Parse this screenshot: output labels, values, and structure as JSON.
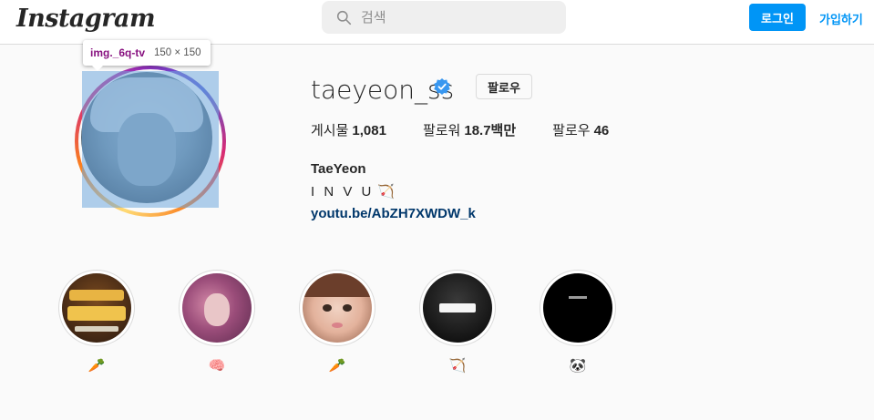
{
  "header": {
    "logo": "Instagram",
    "search_placeholder": "검색",
    "login_label": "로그인",
    "signup_label": "가입하기",
    "accent_color": "#0095f6"
  },
  "devtools_tooltip": {
    "selector": "img._6q-tv",
    "dimensions": "150 × 150"
  },
  "profile": {
    "username": "taeyeon_ss",
    "verified_icon": "verified-badge-icon",
    "follow_label": "팔로우",
    "stats": [
      {
        "label": "게시물",
        "value": "1,081"
      },
      {
        "label": "팔로워",
        "value": "18.7백만"
      },
      {
        "label": "팔로우",
        "value": "46"
      }
    ],
    "full_name": "TaeYeon",
    "bio_text": "I N V U",
    "bio_emoji": "🏹",
    "link": "youtu.be/AbZH7XWDW_k"
  },
  "highlights": [
    {
      "emoji": "🥕",
      "icon": "carrot-icon"
    },
    {
      "emoji": "🧠",
      "icon": "brain-icon"
    },
    {
      "emoji": "🥕",
      "icon": "carrot-icon"
    },
    {
      "emoji": "🏹",
      "icon": "bow-arrow-icon"
    },
    {
      "emoji": "🐼",
      "icon": "panda-icon"
    }
  ]
}
